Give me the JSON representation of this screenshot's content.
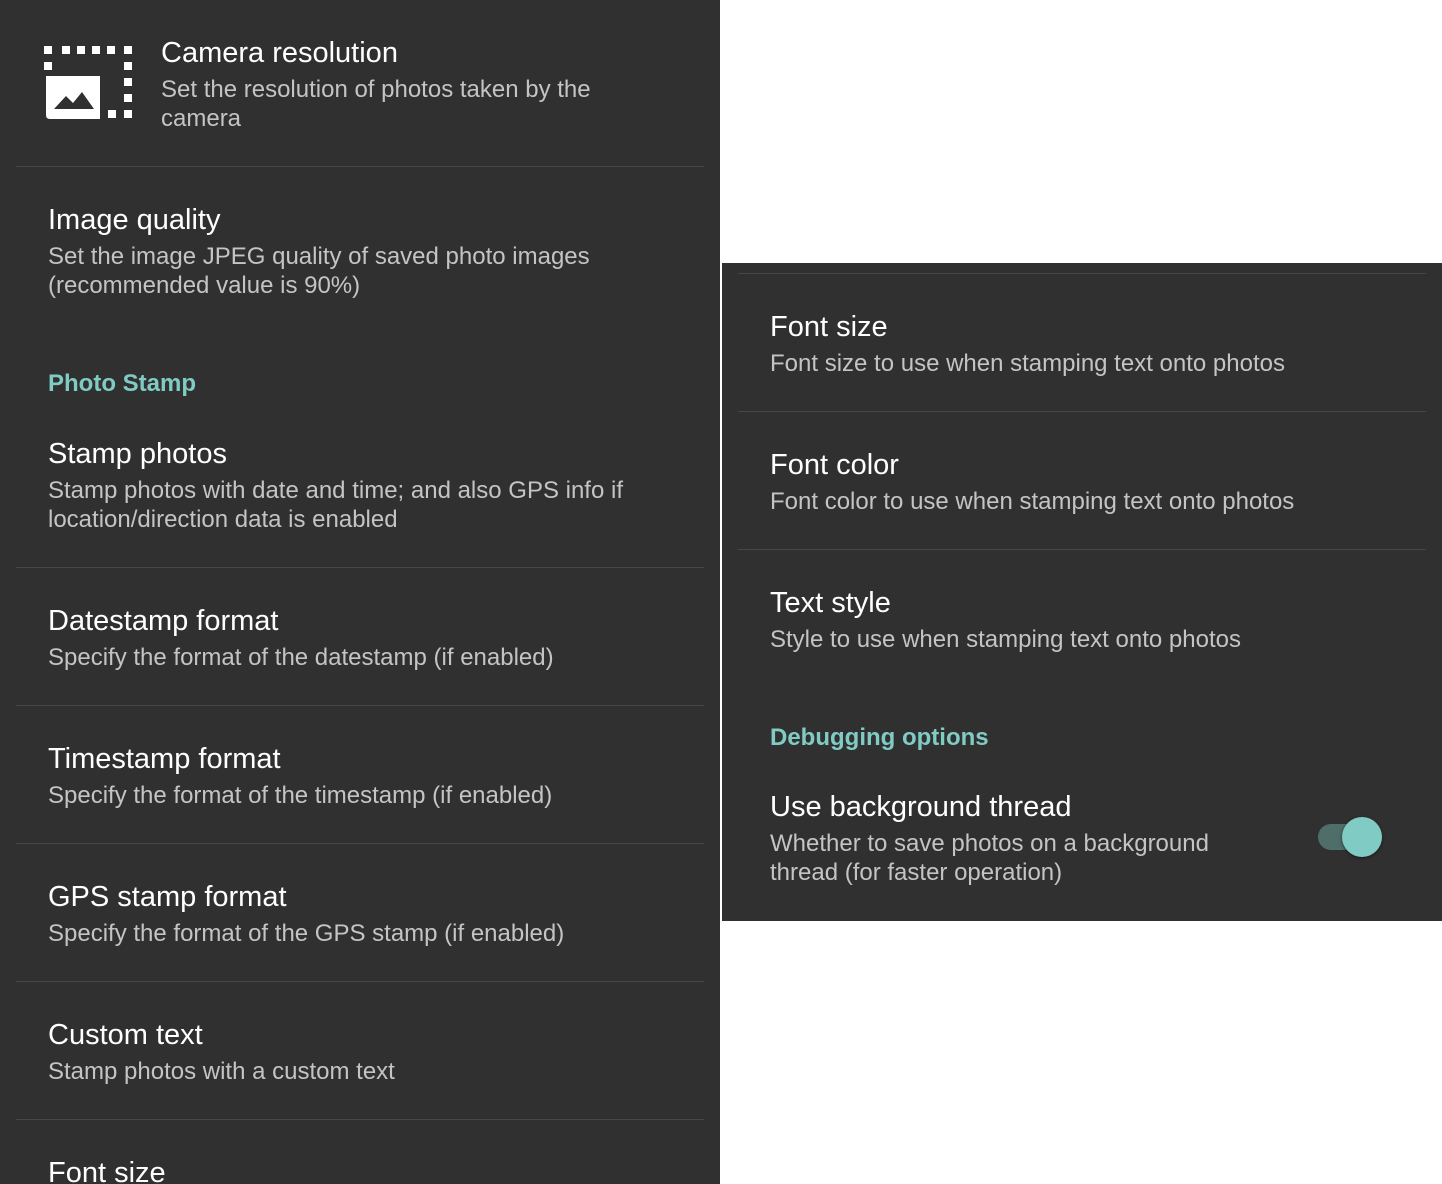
{
  "left": {
    "camera_resolution": {
      "icon": "photo-size-select-icon",
      "title": "Camera resolution",
      "summary": "Set the resolution of photos taken by the camera"
    },
    "image_quality": {
      "title": "Image quality",
      "summary": "Set the image JPEG quality of saved photo images (recommended value is 90%)"
    },
    "photo_stamp_category": "Photo Stamp",
    "stamp_photos": {
      "title": "Stamp photos",
      "summary": "Stamp photos with date and time; and also GPS info if location/direction data is enabled"
    },
    "datestamp_format": {
      "title": "Datestamp format",
      "summary": "Specify the format of the datestamp (if enabled)"
    },
    "timestamp_format": {
      "title": "Timestamp format",
      "summary": "Specify the format of the timestamp (if enabled)"
    },
    "gps_stamp_format": {
      "title": "GPS stamp format",
      "summary": "Specify the format of the GPS stamp (if enabled)"
    },
    "custom_text": {
      "title": "Custom text",
      "summary": "Stamp photos with a custom text"
    },
    "font_size_partial": {
      "title": "Font size"
    }
  },
  "right": {
    "font_size": {
      "title": "Font size",
      "summary": "Font size to use when stamping text onto photos"
    },
    "font_color": {
      "title": "Font color",
      "summary": "Font color to use when stamping text onto photos"
    },
    "text_style": {
      "title": "Text style",
      "summary": "Style to use when stamping text onto photos"
    },
    "debugging_category": "Debugging options",
    "use_background_thread": {
      "title": "Use background thread",
      "summary": "Whether to save photos on a background thread (for faster operation)",
      "enabled": true
    }
  },
  "colors": {
    "panel_background": "#303030",
    "accent": "#80cbc4",
    "title_text": "#ffffff",
    "summary_text": "#c4c4c4",
    "divider": "#474747"
  }
}
